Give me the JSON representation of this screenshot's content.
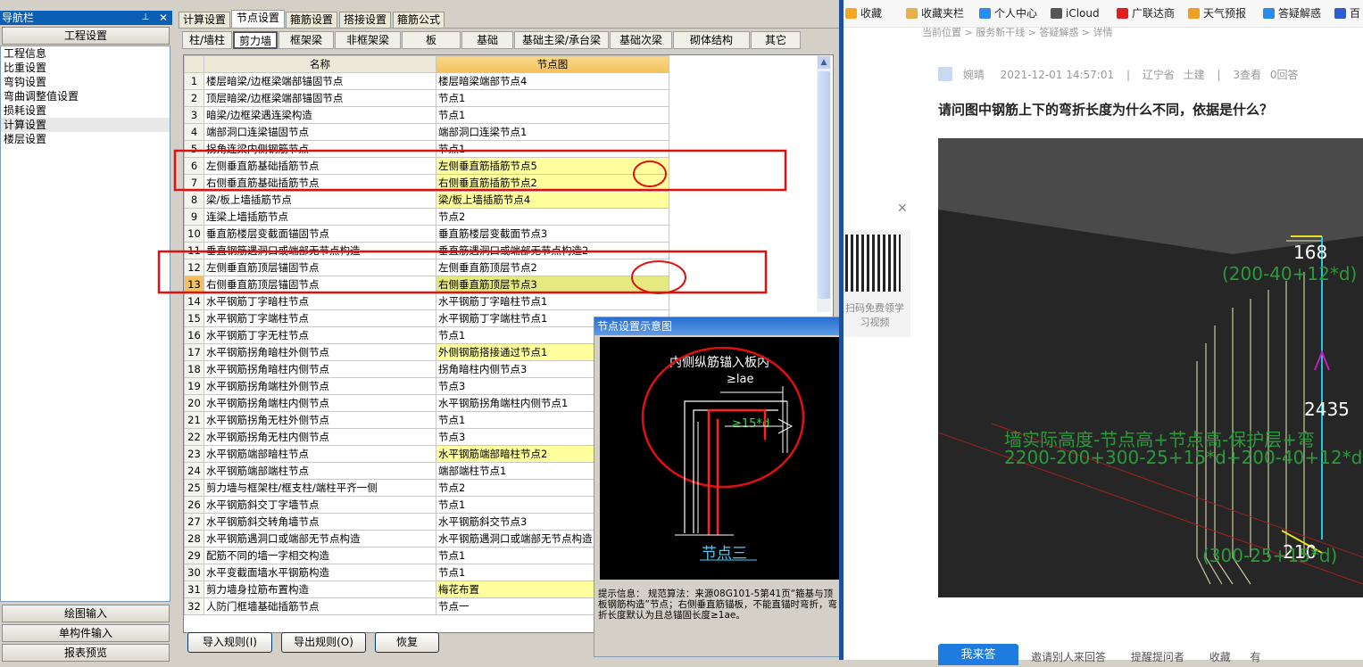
{
  "nav": {
    "title": "导航栏",
    "pin_icon": "pin-icon",
    "section_header": "工程设置",
    "items": [
      "工程信息",
      "比重设置",
      "弯钩设置",
      "弯曲调整值设置",
      "损耗设置",
      "计算设置",
      "楼层设置"
    ],
    "bottom_buttons": [
      "绘图输入",
      "单构件输入",
      "报表预览"
    ]
  },
  "main": {
    "tabs": [
      "计算设置",
      "节点设置",
      "箍筋设置",
      "搭接设置",
      "箍筋公式"
    ],
    "active_tab": "节点设置",
    "subtabs": [
      "柱/墙柱",
      "剪力墙",
      "框架梁",
      "非框架梁",
      "板",
      "基础",
      "基础主梁/承台梁",
      "基础次梁",
      "砌体结构",
      "其它"
    ],
    "active_subtab": "剪力墙",
    "columns": [
      "名称",
      "节点图"
    ],
    "rows": [
      {
        "n": "1",
        "name": "楼层暗梁/边框梁端部锚固节点",
        "val": "楼层暗梁端部节点4",
        "hl": false
      },
      {
        "n": "2",
        "name": "顶层暗梁/边框梁端部锚固节点",
        "val": "节点1",
        "hl": false
      },
      {
        "n": "3",
        "name": "暗梁/边框梁遇连梁构造",
        "val": "节点1",
        "hl": false
      },
      {
        "n": "4",
        "name": "端部洞口连梁锚固节点",
        "val": "端部洞口连梁节点1",
        "hl": false
      },
      {
        "n": "5",
        "name": "拐角连梁内侧钢筋节点",
        "val": "节点1",
        "hl": false
      },
      {
        "n": "6",
        "name": "左侧垂直筋基础插筋节点",
        "val": "左侧垂直筋插筋节点5",
        "hl": true
      },
      {
        "n": "7",
        "name": "右侧垂直筋基础插筋节点",
        "val": "右侧垂直筋插筋节点2",
        "hl": true
      },
      {
        "n": "8",
        "name": "梁/板上墙插筋节点",
        "val": "梁/板上墙插筋节点4",
        "hl": true
      },
      {
        "n": "9",
        "name": "连梁上墙插筋节点",
        "val": "节点2",
        "hl": false
      },
      {
        "n": "10",
        "name": "垂直筋楼层变截面锚固节点",
        "val": "垂直筋楼层变截面节点3",
        "hl": false
      },
      {
        "n": "11",
        "name": "垂直钢筋遇洞口或端部无节点构造",
        "val": "垂直筋遇洞口或端部无节点构造2",
        "hl": false
      },
      {
        "n": "12",
        "name": "左侧垂直筋顶层锚固节点",
        "val": "左侧垂直筋顶层节点2",
        "hl": false
      },
      {
        "n": "13",
        "name": "右侧垂直筋顶层锚固节点",
        "val": "右侧垂直筋顶层节点3",
        "hl": false,
        "sel": true
      },
      {
        "n": "14",
        "name": "水平钢筋丁字暗柱节点",
        "val": "水平钢筋丁字暗柱节点1",
        "hl": false
      },
      {
        "n": "15",
        "name": "水平钢筋丁字端柱节点",
        "val": "水平钢筋丁字端柱节点1",
        "hl": false
      },
      {
        "n": "16",
        "name": "水平钢筋丁字无柱节点",
        "val": "节点1",
        "hl": false
      },
      {
        "n": "17",
        "name": "水平钢筋拐角暗柱外侧节点",
        "val": "外侧钢筋搭接通过节点1",
        "hl": true
      },
      {
        "n": "18",
        "name": "水平钢筋拐角暗柱内侧节点",
        "val": "拐角暗柱内侧节点3",
        "hl": false
      },
      {
        "n": "19",
        "name": "水平钢筋拐角端柱外侧节点",
        "val": "节点3",
        "hl": false
      },
      {
        "n": "20",
        "name": "水平钢筋拐角端柱内侧节点",
        "val": "水平钢筋拐角端柱内侧节点1",
        "hl": false
      },
      {
        "n": "21",
        "name": "水平钢筋拐角无柱外侧节点",
        "val": "节点1",
        "hl": false
      },
      {
        "n": "22",
        "name": "水平钢筋拐角无柱内侧节点",
        "val": "节点3",
        "hl": false
      },
      {
        "n": "23",
        "name": "水平钢筋端部暗柱节点",
        "val": "水平钢筋端部暗柱节点2",
        "hl": true
      },
      {
        "n": "24",
        "name": "水平钢筋端部端柱节点",
        "val": "端部端柱节点1",
        "hl": false
      },
      {
        "n": "25",
        "name": "剪力墙与框架柱/框支柱/端柱平齐一侧",
        "val": "节点2",
        "hl": false
      },
      {
        "n": "26",
        "name": "水平钢筋斜交丁字墙节点",
        "val": "节点1",
        "hl": false
      },
      {
        "n": "27",
        "name": "水平钢筋斜交转角墙节点",
        "val": "水平钢筋斜交节点3",
        "hl": false
      },
      {
        "n": "28",
        "name": "水平钢筋遇洞口或端部无节点构造",
        "val": "水平钢筋遇洞口或端部无节点构造",
        "hl": false
      },
      {
        "n": "29",
        "name": "配筋不同的墙一字相交构造",
        "val": "节点1",
        "hl": false
      },
      {
        "n": "30",
        "name": "水平变截面墙水平钢筋构造",
        "val": "节点1",
        "hl": false
      },
      {
        "n": "31",
        "name": "剪力墙身拉筋布置构造",
        "val": "梅花布置",
        "hl": true
      },
      {
        "n": "32",
        "name": "人防门框墙基础插筋节点",
        "val": "节点一",
        "hl": false
      }
    ],
    "buttons": [
      "导入规则(I)",
      "导出规则(O)",
      "恢复"
    ]
  },
  "popup": {
    "title": "节点设置示意图",
    "diagram_caption": "内侧纵筋锚入板内",
    "dim_lae": "≥lae",
    "dim_15d": "≥15*d",
    "node_label": "节点三",
    "hint_label": "提示信息：",
    "hint_text": "规范算法：来源08G101-5第41页“箍基与顶板钢筋构造”节点；右侧垂直筋锚板，不能直锚时弯折，弯折长度默认为且总锚固长度≥1ae。"
  },
  "browser": {
    "bookmarks": [
      {
        "label": "收藏",
        "icon": "star-icon",
        "color": "#f5a623"
      },
      {
        "label": "收藏夹栏",
        "icon": "folder-icon",
        "color": "#e8b14a"
      },
      {
        "label": "个人中心",
        "icon": "user-icon",
        "color": "#2b8cf0"
      },
      {
        "label": "iCloud",
        "icon": "apple-icon",
        "color": "#555555"
      },
      {
        "label": "广联达商",
        "icon": "brand-icon",
        "color": "#e02020"
      },
      {
        "label": "天气预报",
        "icon": "weather-icon",
        "color": "#f0a020"
      },
      {
        "label": "答疑解惑",
        "icon": "answer-icon",
        "color": "#2b8cf0"
      },
      {
        "label": "百",
        "icon": "baidu-icon",
        "color": "#2b5cd6"
      }
    ],
    "breadcrumb": "当前位置 > 服务新干线 > 答疑解惑 > 详情",
    "author": "婉晴",
    "date": "2021-12-01 14:57:01",
    "region": "辽宁省",
    "category": "土建",
    "views": "3查看",
    "answers": "0回答",
    "question": "请问图中钢筋上下的弯折长度为什么不同，依据是什么？",
    "qr_text": "扫码免费领学习视频",
    "photo": {
      "dim_top": "168",
      "formula_top": "(200-40+12*d)",
      "dim_mid": "2435",
      "formula_mid1": "墙实际高度-节点高+节点高-保护层+弯",
      "formula_mid2": "2200-200+300-25+15*d+200-40+12*d",
      "dim_bottom": "210",
      "formula_bottom": "(300-25+15*d)"
    },
    "answer_button": "我来答",
    "actions": [
      "邀请别人来回答",
      "提醒提问者",
      "收藏",
      "有"
    ]
  }
}
